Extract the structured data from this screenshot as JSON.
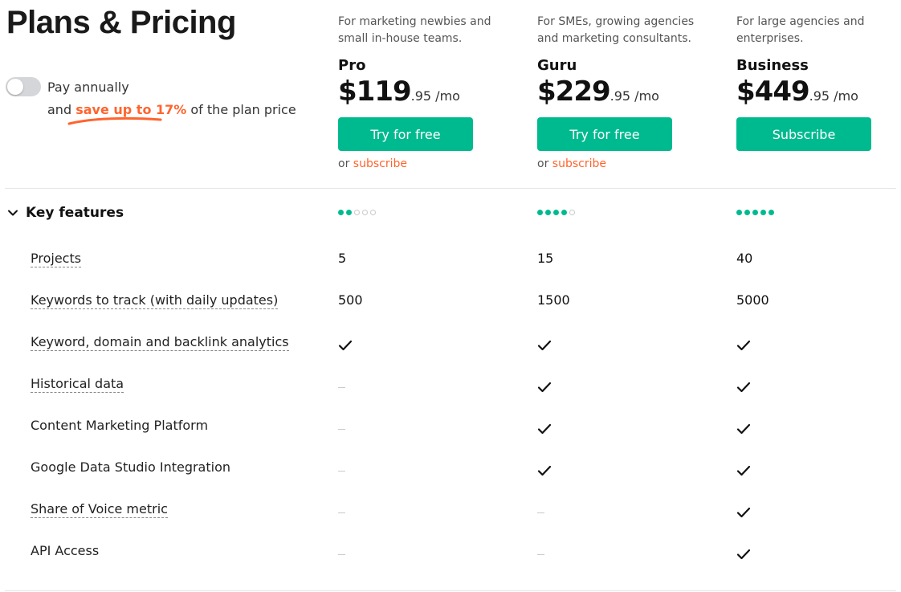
{
  "page": {
    "title": "Plans & Pricing"
  },
  "billing": {
    "toggle_label": "Pay annually",
    "save_prefix": "and",
    "save_highlight": "save up to 17%",
    "save_suffix": "of the plan price",
    "toggle_on": false
  },
  "plans": [
    {
      "description_line1": "For marketing newbies and",
      "description_line2": "small in-house teams.",
      "name": "Pro",
      "price_main": "$119",
      "price_cents": ".95 /mo",
      "button_label": "Try for free",
      "or_text": "or",
      "subscribe_link": "subscribe",
      "level": 2
    },
    {
      "description_line1": "For SMEs, growing agencies",
      "description_line2": "and marketing consultants.",
      "name": "Guru",
      "price_main": "$229",
      "price_cents": ".95 /mo",
      "button_label": "Try for free",
      "or_text": "or",
      "subscribe_link": "subscribe",
      "level": 4
    },
    {
      "description_line1": "For large agencies and",
      "description_line2": "enterprises.",
      "name": "Business",
      "price_main": "$449",
      "price_cents": ".95 /mo",
      "button_label": "Subscribe",
      "level": 5
    }
  ],
  "key_features": {
    "heading": "Key features",
    "max_level": 5,
    "rows": [
      {
        "label": "Projects",
        "values": [
          "5",
          "15",
          "40"
        ]
      },
      {
        "label": "Keywords to track (with daily updates)",
        "values": [
          "500",
          "1500",
          "5000"
        ]
      },
      {
        "label": "Keyword, domain and backlink analytics",
        "values": [
          true,
          true,
          true
        ]
      },
      {
        "label": "Historical data",
        "values": [
          false,
          true,
          true
        ]
      },
      {
        "label": "Content Marketing Platform",
        "values": [
          false,
          true,
          true
        ]
      },
      {
        "label": "Google Data Studio Integration",
        "values": [
          false,
          true,
          true
        ]
      },
      {
        "label": "Share of Voice metric",
        "values": [
          false,
          false,
          true
        ]
      },
      {
        "label": "API Access",
        "values": [
          false,
          false,
          true
        ]
      }
    ]
  },
  "colors": {
    "accent_green": "#00ba8f",
    "accent_orange": "#ff642d"
  },
  "icons": {
    "toggle": "toggle-switch",
    "section": "chevron-down-icon",
    "included": "checkmark-icon",
    "not_included": "dash-icon"
  }
}
